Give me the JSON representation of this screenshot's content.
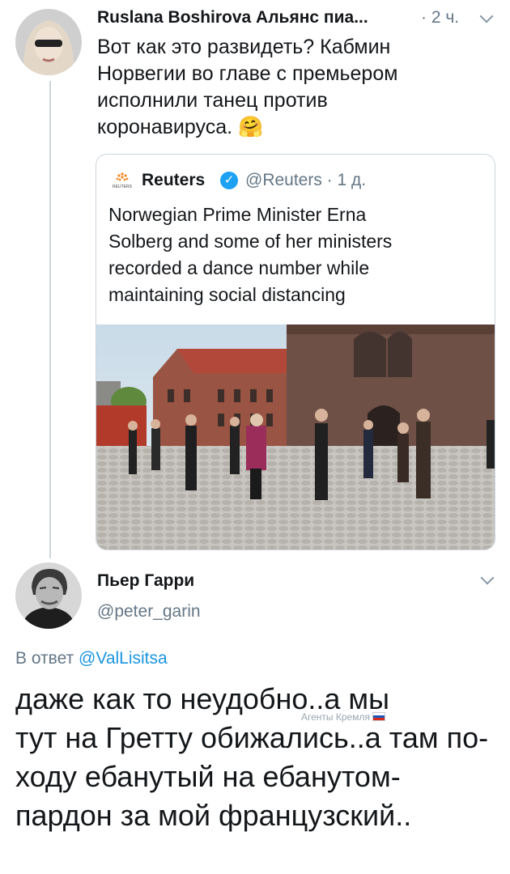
{
  "tweet1": {
    "author": "Ruslana Boshirova Альянс пиа...",
    "time": "· 2 ч.",
    "text": "Вот как это развидеть? Кабмин Норвегии во главе с премьером исполнили танец против коронавируса.",
    "emoji": "🤗"
  },
  "quote": {
    "logo_text": "REUTERS",
    "author": "Reuters",
    "handle": "@Reuters · 1 д.",
    "text": "Norwegian Prime Minister Erna Solberg and some of her ministers recorded a dance number while maintaining social distancing"
  },
  "tweet2": {
    "author": "Пьер Гарри",
    "handle": "@peter_garin",
    "reply_prefix": "В ответ",
    "reply_to": "@ValLisitsa",
    "text_line1": "даже как то неудобно..а мы",
    "text_rest": "тут на Гретту обижались..а там по-ходу ебанутый на ебанутом-пардон за мой французский.."
  },
  "watermark": {
    "text": "Агенты Кремля"
  }
}
